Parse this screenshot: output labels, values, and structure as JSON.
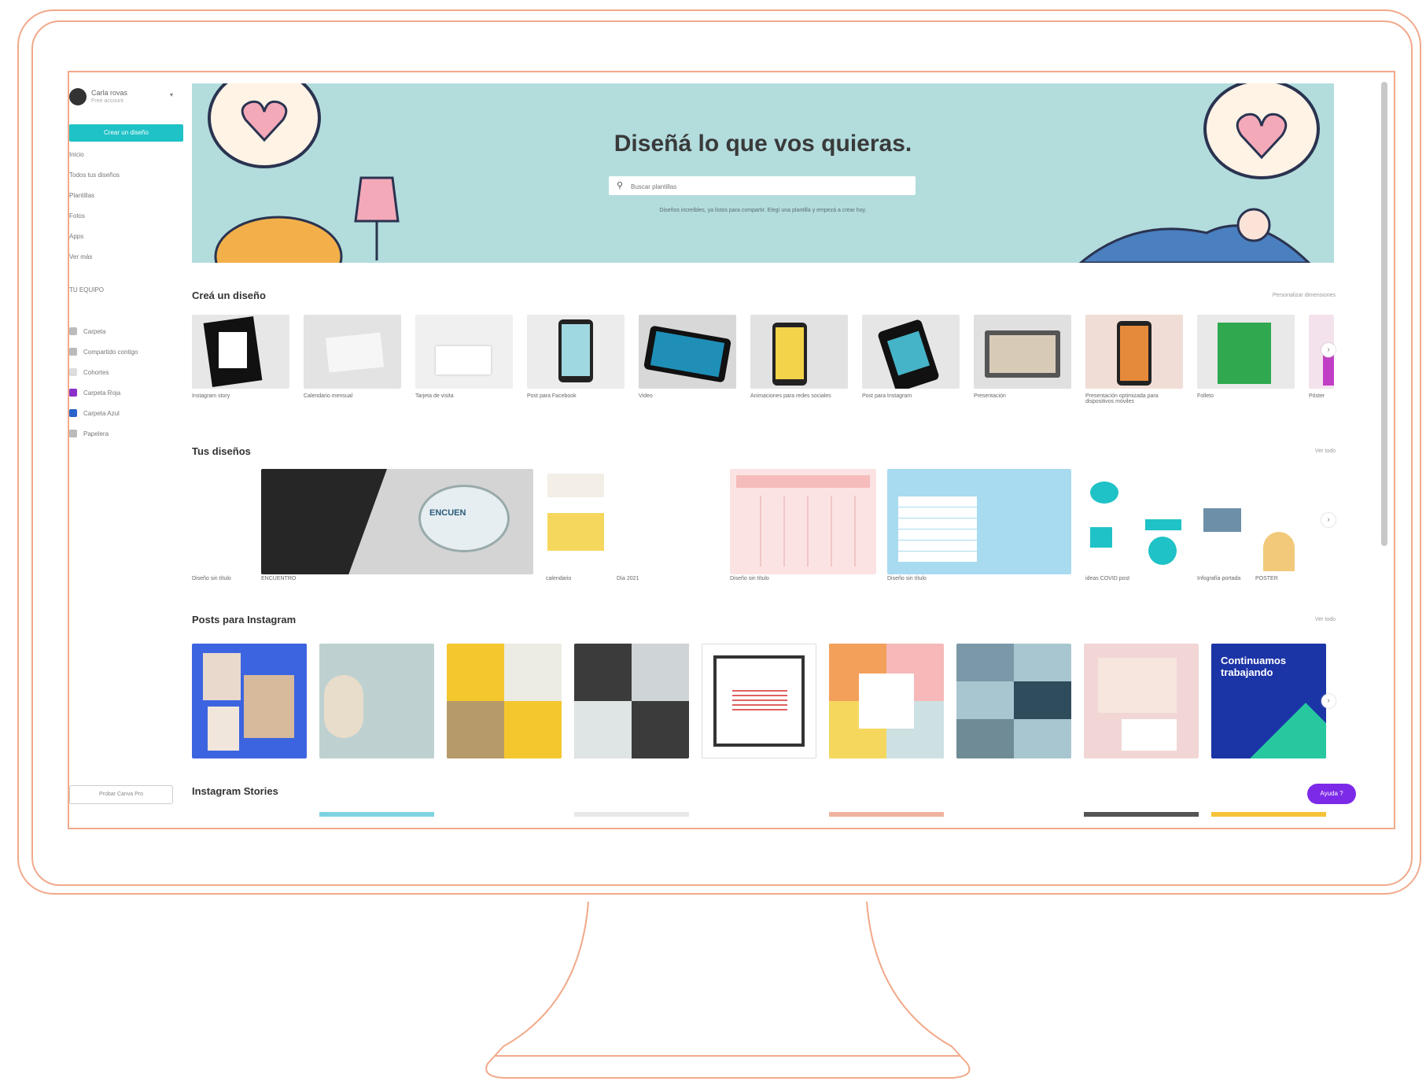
{
  "account": {
    "name": "Carla rovas",
    "subtitle": "Free account"
  },
  "sidebar": {
    "create_label": "Crear un diseño",
    "items": [
      {
        "label": "Inicio"
      },
      {
        "label": "Todos tus diseños"
      },
      {
        "label": "Plantillas"
      },
      {
        "label": "Fotos"
      },
      {
        "label": "Apps"
      },
      {
        "label": "Ver más"
      }
    ],
    "teams_label": "TU EQUIPO",
    "teams": [
      {
        "label": "Carpeta"
      },
      {
        "label": "Compartido contigo"
      },
      {
        "label": "Cohortes"
      },
      {
        "label": "Carpeta Roja"
      },
      {
        "label": "Carpeta Azul"
      },
      {
        "label": "Papelera"
      }
    ],
    "upgrade_label": "Probar Canva Pro"
  },
  "hero": {
    "title": "Diseñá lo que vos quieras.",
    "search_placeholder": "Buscar plantillas",
    "hint": "Diseños increíbles, ya listos para compartir. Elegí una plantilla y empezá a crear hoy."
  },
  "sections": {
    "create": {
      "title": "Creá un diseño",
      "link": "Personalizar dimensiones",
      "cards": [
        {
          "label": "Instagram story"
        },
        {
          "label": "Calendario mensual"
        },
        {
          "label": "Tarjeta de visita"
        },
        {
          "label": "Post para Facebook"
        },
        {
          "label": "Video"
        },
        {
          "label": "Animaciones para redes sociales"
        },
        {
          "label": "Post para Instagram"
        },
        {
          "label": "Presentación"
        },
        {
          "label": "Presentación optimizada para dispositivos móviles"
        },
        {
          "label": "Folleto"
        },
        {
          "label": "Póster"
        }
      ]
    },
    "designs": {
      "title": "Tus diseños",
      "link": "Ver todo",
      "cards": [
        {
          "label": "Diseño sin título"
        },
        {
          "label": "ENCUENTRO"
        },
        {
          "label": "calendario"
        },
        {
          "label": "Día 2021"
        },
        {
          "label": "Diseño sin título"
        },
        {
          "label": "Diseño sin título"
        },
        {
          "label": "ideas COVID post"
        },
        {
          "label": "Infografía portada"
        },
        {
          "label": "POSTER"
        }
      ]
    },
    "instagram": {
      "title": "Posts para Instagram",
      "link": "Ver todo",
      "cards": [
        {
          "label": ""
        },
        {
          "label": ""
        },
        {
          "label": ""
        },
        {
          "label": ""
        },
        {
          "label": ""
        },
        {
          "label": ""
        },
        {
          "label": ""
        },
        {
          "label": ""
        },
        {
          "label": "Continuamos trabajando"
        }
      ]
    },
    "stories": {
      "title": "Instagram Stories"
    }
  },
  "help_label": "Ayuda ?",
  "colors": {
    "accent": "#1fc2c6",
    "hero_bg": "#b3dcdd",
    "monitor_outline": "#f2a98a",
    "help": "#7d2ae8"
  }
}
